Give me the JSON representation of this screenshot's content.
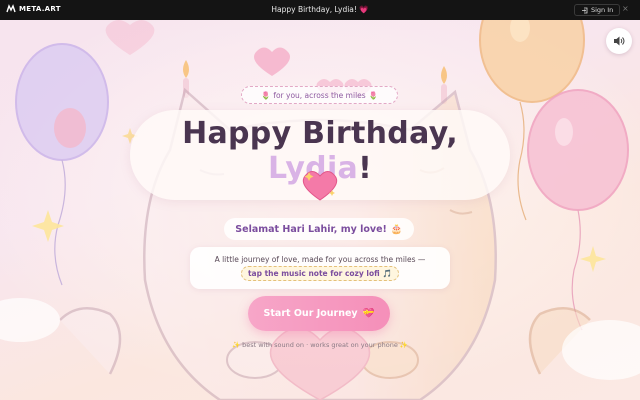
{
  "topbar": {
    "brand": "META.ART",
    "tab_title": "Happy Birthday, Lydia! 💗",
    "signin_label": "Sign In",
    "close_glyph": "×"
  },
  "hero": {
    "kicker_text": "for you, across the miles",
    "kicker_icon": "🌷",
    "title_prefix": "Happy Birthday, ",
    "title_name": "Lydia",
    "title_suffix": "!",
    "title_emoji": "💖",
    "subtitle_text": "Selamat Hari Lahir, my love!",
    "subtitle_emoji": "🎂",
    "description": "A little journey of love, made for you across the miles —",
    "description_highlight": "tap the music note for cozy lofi",
    "description_highlight_emoji": "🎵",
    "cta_label": "Start Our Journey",
    "cta_emoji": "💝",
    "hint_text": "best with sound on · works great on your phone",
    "hint_emoji": "✨"
  },
  "icons": {
    "sound": "speaker-icon",
    "signin": "login-icon",
    "brand": "meta-logo-icon"
  }
}
